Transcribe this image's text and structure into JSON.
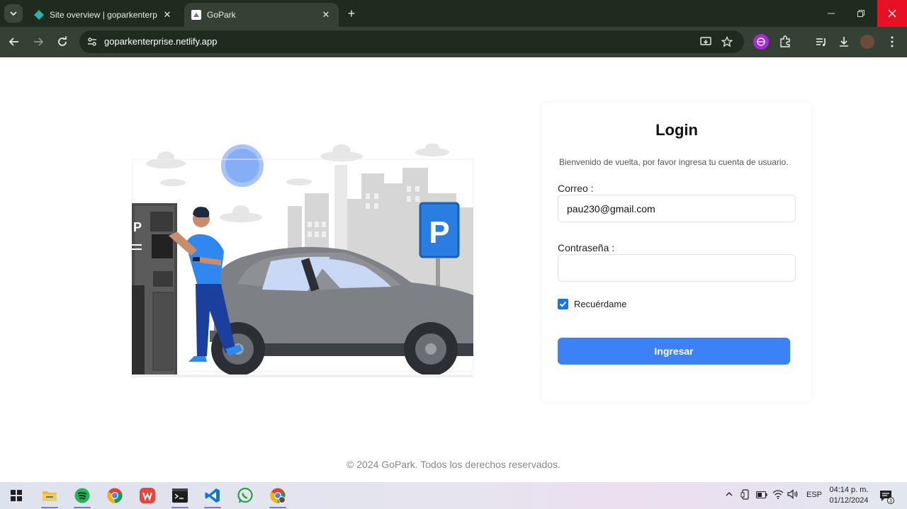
{
  "browser": {
    "tabs": [
      {
        "title": "Site overview | goparkenterprise",
        "active": false
      },
      {
        "title": "GoPark",
        "active": true
      }
    ],
    "url": "goparkenterprise.netlify.app",
    "close_glyph": "✕",
    "new_tab_glyph": "+"
  },
  "login": {
    "title": "Login",
    "subtitle": "Bienvenido de vuelta, por favor ingresa tu cuenta de usuario.",
    "email_label": "Correo :",
    "email_value": "pau230@gmail.com",
    "password_label": "Contraseña :",
    "password_value": "",
    "remember_label": "Recuérdame",
    "remember_checked": true,
    "submit_label": "Ingresar"
  },
  "illustration": {
    "parking_sign": "P",
    "meter_sign": "P"
  },
  "footer": {
    "text": "© 2024 GoPark. Todos los derechos reservados."
  },
  "taskbar": {
    "language": "ESP",
    "time": "04:14 p. m.",
    "date": "01/12/2024",
    "notification_count": "3",
    "apps": [
      "windows-start",
      "file-explorer",
      "spotify",
      "chrome",
      "wps-office",
      "terminal",
      "vscode",
      "whatsapp",
      "chrome-profile"
    ]
  },
  "colors": {
    "accent": "#3b82f6",
    "chrome_dark": "#1f2b1f",
    "chrome_toolbar": "#364136",
    "parking_blue": "#2a7de1",
    "close_red": "#e81123"
  }
}
